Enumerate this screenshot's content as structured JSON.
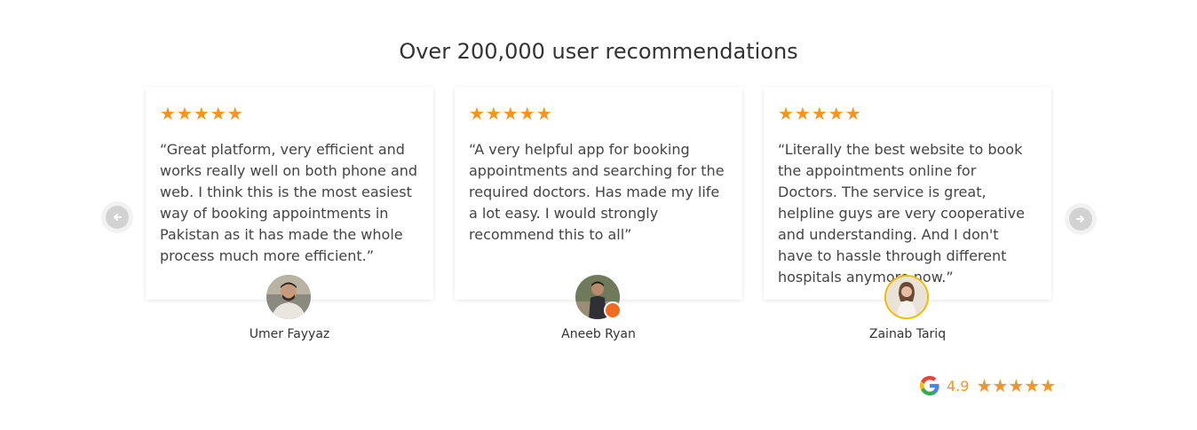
{
  "section": {
    "title": "Over 200,000 user recommendations"
  },
  "testimonials": [
    {
      "stars": "★★★★★",
      "quote": "“Great platform, very efficient and works really well on both phone and web. I think this is the most easiest way of booking appointments in Pakistan as it has made the whole process much more efficient.”",
      "name": "Umer Fayyaz",
      "rating": 5
    },
    {
      "stars": "★★★★★",
      "quote": "“A very helpful app for booking appointments and searching for the required doctors. Has made my life a lot easy. I would strongly recommend this to all”",
      "name": "Aneeb Ryan",
      "rating": 5
    },
    {
      "stars": "★★★★★",
      "quote": "“Literally the best website to book the appointments online for Doctors. The service is great, helpline guys are very cooperative and understanding. And I don't have to hassle through different hospitals anymore now.”",
      "name": "Zainab Tariq",
      "rating": 5
    }
  ],
  "carousel": {
    "prev_icon": "arrow-left-icon",
    "next_icon": "arrow-right-icon"
  },
  "google_rating": {
    "icon": "google-logo-icon",
    "value": "4.9",
    "stars": "★★★★★",
    "stars_filled": 5
  },
  "colors": {
    "star": "#f7941d",
    "avatar_ring": "#f5b800",
    "badge": "#f26b21",
    "arrow_bg": "#d2d2d2"
  }
}
